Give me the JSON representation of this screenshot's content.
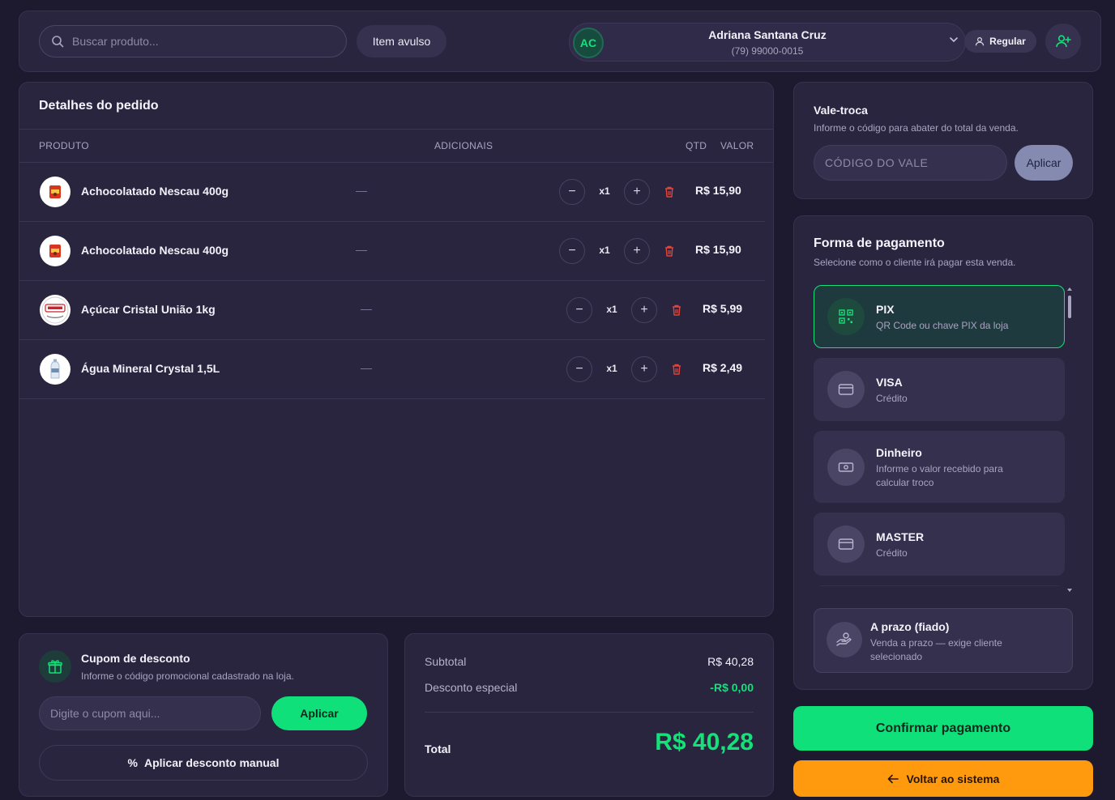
{
  "topbar": {
    "search_placeholder": "Buscar produto...",
    "item_avulso_label": "Item avulso",
    "client": {
      "initials": "AC",
      "name": "Adriana Santana Cruz",
      "phone": "(79) 99000-0015"
    },
    "customer_type_label": "Regular"
  },
  "order": {
    "title": "Detalhes do pedido",
    "columns": {
      "product": "PRODUTO",
      "addons": "ADICIONAIS",
      "qty": "QTD",
      "value": "VALOR"
    },
    "items": [
      {
        "name": "Achocolatado Nescau 400g",
        "addons": "—",
        "qty": "x1",
        "price": "R$ 15,90",
        "thumb_icon": "nescau-product-icon"
      },
      {
        "name": "Achocolatado Nescau 400g",
        "addons": "—",
        "qty": "x1",
        "price": "R$ 15,90",
        "thumb_icon": "nescau-product-icon"
      },
      {
        "name": "Açúcar Cristal União 1kg",
        "addons": "—",
        "qty": "x1",
        "price": "R$ 5,99",
        "thumb_icon": "uniao-product-icon"
      },
      {
        "name": "Água Mineral Crystal 1,5L",
        "addons": "—",
        "qty": "x1",
        "price": "R$ 2,49",
        "thumb_icon": "water-bottle-icon"
      }
    ]
  },
  "coupon": {
    "title": "Cupom de desconto",
    "subtitle": "Informe o código promocional cadastrado na loja.",
    "input_placeholder": "Digite o cupom aqui...",
    "apply_label": "Aplicar",
    "manual_label": "Aplicar desconto manual"
  },
  "totals": {
    "subtotal_label": "Subtotal",
    "subtotal_value": "R$ 40,28",
    "discount_label": "Desconto especial",
    "discount_value": "-R$ 0,00",
    "total_label": "Total",
    "total_value": "R$ 40,28"
  },
  "vale_troca": {
    "title": "Vale-troca",
    "subtitle": "Informe o código para abater do total da venda.",
    "input_placeholder": "CÓDIGO DO VALE",
    "apply_label": "Aplicar"
  },
  "payment": {
    "title": "Forma de pagamento",
    "subtitle": "Selecione como o cliente irá pagar esta venda.",
    "options": [
      {
        "name": "PIX",
        "desc": "QR Code ou chave PIX da loja",
        "icon": "qr-code-icon",
        "selected": true
      },
      {
        "name": "VISA",
        "desc": "Crédito",
        "icon": "credit-card-icon",
        "selected": false
      },
      {
        "name": "Dinheiro",
        "desc": "Informe o valor recebido para calcular troco",
        "icon": "cash-icon",
        "selected": false
      },
      {
        "name": "MASTER",
        "desc": "Crédito",
        "icon": "credit-card-icon",
        "selected": false
      }
    ],
    "prazo": {
      "name": "A prazo (fiado)",
      "desc": "Venda a prazo — exige cliente selecionado",
      "icon": "hand-coin-icon"
    }
  },
  "actions": {
    "confirm_label": "Confirmar pagamento",
    "back_label": "Voltar ao sistema"
  },
  "colors": {
    "accent_green": "#10e07a",
    "accent_orange": "#ff9a0f",
    "danger_red": "#e0443a",
    "panel_bg": "#29253f",
    "page_bg": "#1d1a30"
  }
}
